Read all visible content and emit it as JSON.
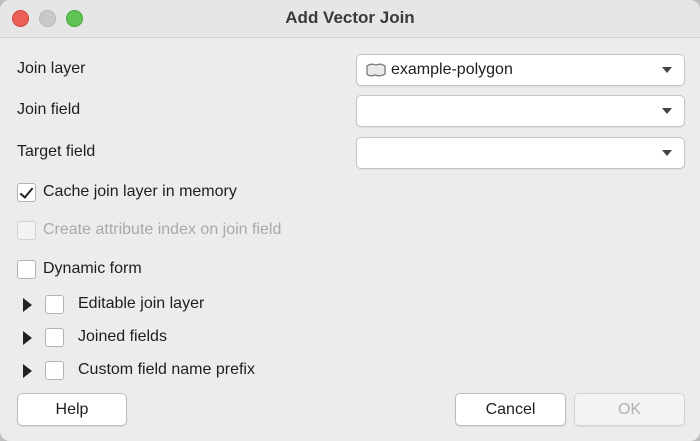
{
  "window": {
    "title": "Add Vector Join"
  },
  "form": {
    "join_layer": {
      "label": "Join layer",
      "value": "example-polygon",
      "icon": "polygon-layer-icon"
    },
    "join_field": {
      "label": "Join field",
      "value": ""
    },
    "target_field": {
      "label": "Target field",
      "value": ""
    }
  },
  "options": {
    "cache": {
      "label": "Cache join layer in memory",
      "checked": true
    },
    "create_index": {
      "label": "Create attribute index on join field",
      "checked": false,
      "enabled": false
    },
    "dynamic_form": {
      "label": "Dynamic form",
      "checked": false
    }
  },
  "groups": [
    {
      "label": "Editable join layer",
      "checked": false,
      "expanded": false
    },
    {
      "label": "Joined fields",
      "checked": false,
      "expanded": false
    },
    {
      "label": "Custom field name prefix",
      "checked": false,
      "expanded": false
    }
  ],
  "buttons": {
    "help": "Help",
    "cancel": "Cancel",
    "ok": "OK"
  },
  "colors": {
    "close": "#ec5f57",
    "maximize": "#5fc453",
    "window_bg": "#ececec"
  }
}
